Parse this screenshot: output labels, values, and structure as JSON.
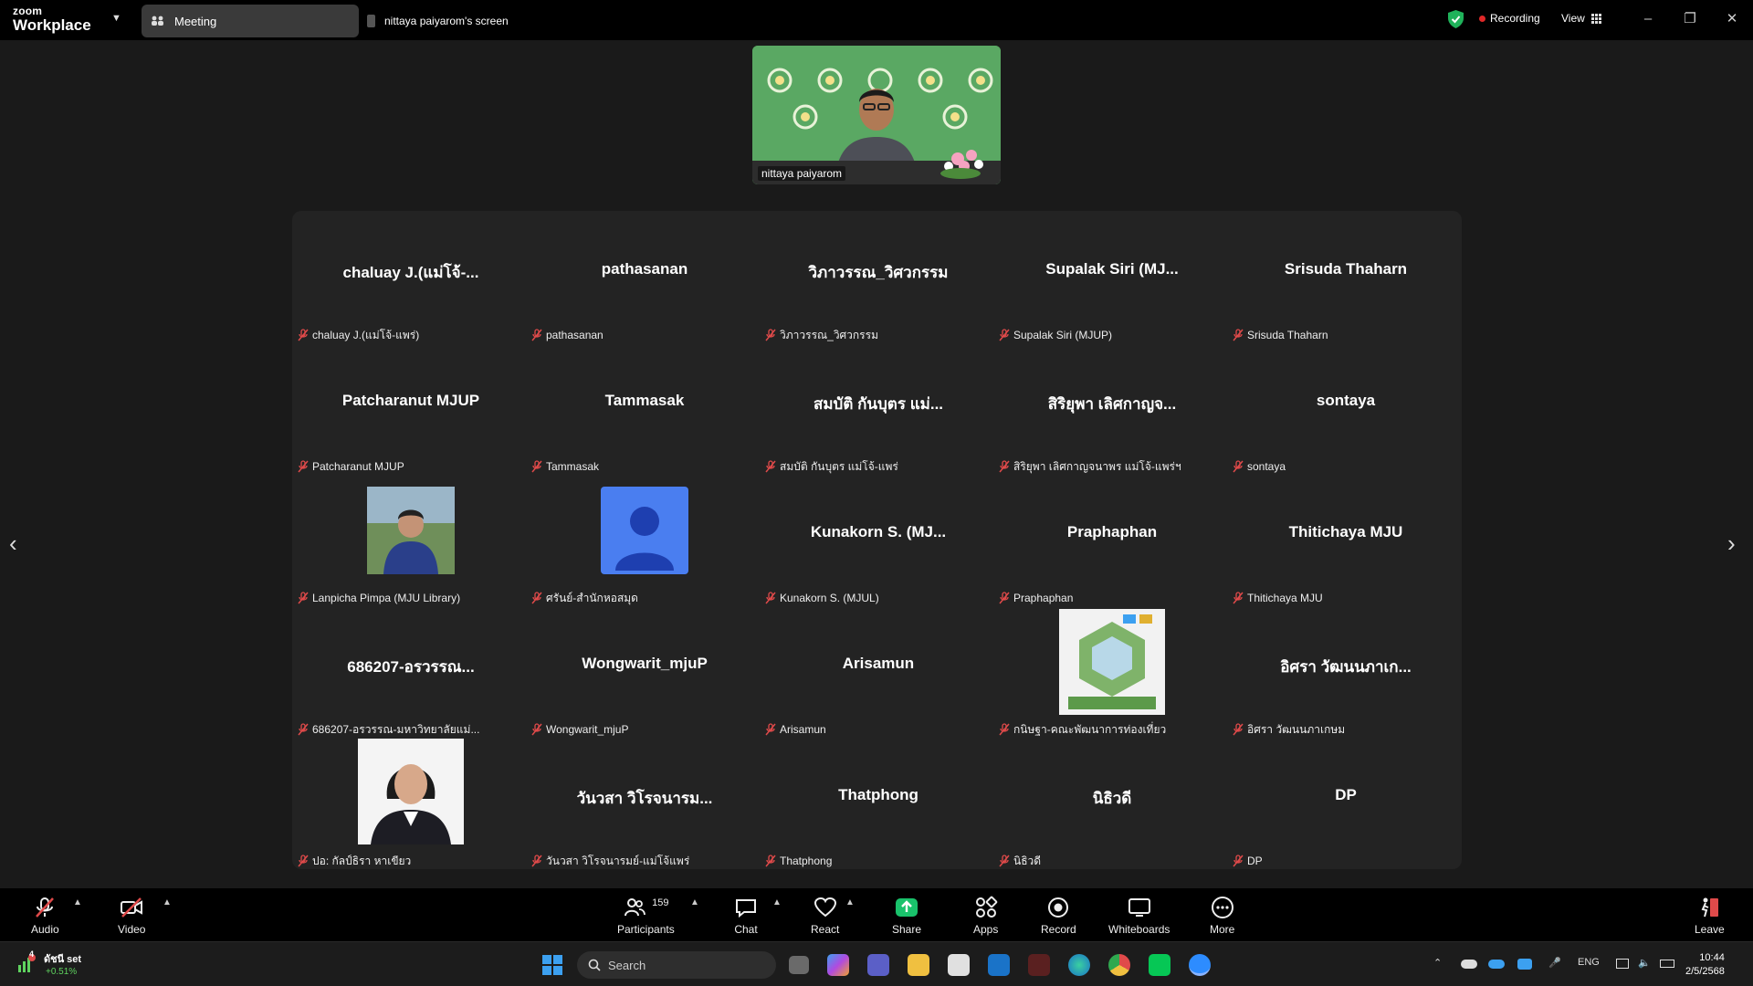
{
  "app": {
    "brand_top": "zoom",
    "brand_bottom": "Workplace"
  },
  "tabs": {
    "meeting": "Meeting",
    "screen": "nittaya paiyarom's screen"
  },
  "status": {
    "recording": "Recording",
    "view": "View"
  },
  "main_video": {
    "name": "nittaya paiyarom"
  },
  "participants_grid": [
    {
      "display": "chaluay J.(แม่โจ้-...",
      "label": "chaluay J.(แม่โจ้-แพร่)"
    },
    {
      "display": "pathasanan",
      "label": "pathasanan"
    },
    {
      "display": "วิภาวรรณ_วิศวกรรม",
      "label": "วิภาวรรณ_วิศวกรรม"
    },
    {
      "display": "Supalak Siri (MJ...",
      "label": "Supalak Siri (MJUP)"
    },
    {
      "display": "Srisuda Thaharn",
      "label": "Srisuda Thaharn"
    },
    {
      "display": "Patcharanut MJUP",
      "label": "Patcharanut MJUP"
    },
    {
      "display": "Tammasak",
      "label": "Tammasak"
    },
    {
      "display": "สมบัติ  กันบุตร แม่...",
      "label": "สมบัติ  กันบุตร แม่โจ้-แพร่"
    },
    {
      "display": "สิริยุพา เลิศกาญจ...",
      "label": "สิริยุพา เลิศกาญจนาพร แม่โจ้-แพร่ฯ"
    },
    {
      "display": "sontaya",
      "label": "sontaya"
    },
    {
      "display": "",
      "label": "Lanpicha Pimpa (MJU Library)",
      "photo": "person-photo"
    },
    {
      "display": "",
      "label": "ศรันย์-สำนักหอสมุด",
      "photo": "default-avatar"
    },
    {
      "display": "Kunakorn S. (MJ...",
      "label": "Kunakorn S. (MJUL)"
    },
    {
      "display": "Praphaphan",
      "label": "Praphaphan"
    },
    {
      "display": "Thitichaya MJU",
      "label": "Thitichaya MJU"
    },
    {
      "display": "686207-อรวรรณ...",
      "label": "686207-อรวรรณ-มหาวิทยาลัยแม่..."
    },
    {
      "display": "Wongwarit_mjuP",
      "label": "Wongwarit_mjuP"
    },
    {
      "display": "Arisamun",
      "label": "Arisamun"
    },
    {
      "display": "",
      "label": "กนิษฐา-คณะพัฒนาการท่องเที่ยว",
      "photo": "building-photo"
    },
    {
      "display": "อิศรา วัฒนนภาเก...",
      "label": "อิศรา วัฒนนภาเกษม"
    },
    {
      "display": "",
      "label": "ปอ: กัลป์ธิรา หาเขียว",
      "photo": "woman-photo"
    },
    {
      "display": "วันวสา วิโรจนารม...",
      "label": "วันวสา วิโรจนารมย์-แม่โจ้แพร่"
    },
    {
      "display": "Thatphong",
      "label": "Thatphong"
    },
    {
      "display": "นิธิวดี",
      "label": "นิธิวดี"
    },
    {
      "display": "DP",
      "label": "DP"
    }
  ],
  "toolbar": {
    "audio": "Audio",
    "video": "Video",
    "participants": "Participants",
    "participants_count": "159",
    "chat": "Chat",
    "react": "React",
    "share": "Share",
    "apps": "Apps",
    "record": "Record",
    "whiteboards": "Whiteboards",
    "more": "More",
    "leave": "Leave"
  },
  "taskbar": {
    "stock_name": "ดัชนี set",
    "stock_change": "+0.51%",
    "stock_badge": "4",
    "search_placeholder": "Search",
    "lang": "ENG",
    "time": "10:44",
    "date": "2/5/2568"
  },
  "colors": {
    "share_green": "#19c26b",
    "mute_red": "#e04a4a",
    "avatar_blue": "#4a7ef0",
    "rec_red": "#e02828"
  }
}
